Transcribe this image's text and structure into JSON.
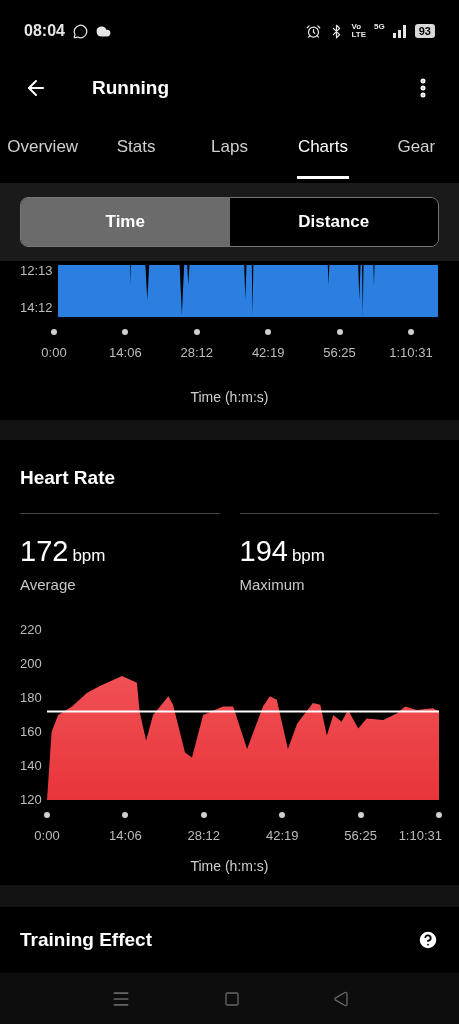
{
  "status_bar": {
    "time": "08:04",
    "battery": "93",
    "network": "5G",
    "volte_top": "Vo",
    "volte_bottom": "LTE"
  },
  "header": {
    "title": "Running"
  },
  "tabs": [
    {
      "label": "Overview",
      "selected": false
    },
    {
      "label": "Stats",
      "selected": false
    },
    {
      "label": "Laps",
      "selected": false
    },
    {
      "label": "Charts",
      "selected": true
    },
    {
      "label": "Gear",
      "selected": false
    }
  ],
  "segments": [
    {
      "label": "Time",
      "selected": true
    },
    {
      "label": "Distance",
      "selected": false
    }
  ],
  "pace_chart": {
    "y_ticks": [
      "12:13",
      "14:12"
    ],
    "x_ticks": [
      "0:00",
      "14:06",
      "28:12",
      "42:19",
      "56:25",
      "1:10:31"
    ],
    "xlabel": "Time (h:m:s)"
  },
  "heart_rate": {
    "title": "Heart Rate",
    "stats": [
      {
        "value": "172",
        "unit": "bpm",
        "label": "Average"
      },
      {
        "value": "194",
        "unit": "bpm",
        "label": "Maximum"
      }
    ],
    "chart_data": {
      "type": "area",
      "xlabel": "Time (h:m:s)",
      "x": [
        0,
        50,
        120,
        270,
        430,
        570,
        810,
        970,
        1000,
        1070,
        1145,
        1310,
        1360,
        1490,
        1565,
        1685,
        1900,
        2010,
        2160,
        2330,
        2405,
        2480,
        2600,
        2700,
        2870,
        2950,
        3020,
        3090,
        3180,
        3250,
        3360,
        3450,
        3630,
        3780,
        3865,
        3990,
        4165,
        4231
      ],
      "series": [
        {
          "color": "#e8353a",
          "values": [
            120,
            160,
            170,
            175,
            183,
            187,
            193,
            189,
            172,
            155,
            170,
            181,
            176,
            148,
            145,
            170,
            175,
            175,
            150,
            175,
            181,
            179,
            150,
            165,
            177,
            176,
            158,
            170,
            166,
            173,
            162,
            168,
            167,
            171,
            175,
            173,
            174,
            172
          ]
        },
        {
          "type": "line",
          "color": "#ffffff",
          "values": [
            172,
            172,
            172,
            172,
            172,
            172,
            172,
            172,
            172,
            172,
            172,
            172,
            172,
            172,
            172,
            172,
            172,
            172,
            172,
            172,
            172,
            172,
            172,
            172,
            172,
            172,
            172,
            172,
            172,
            172,
            172,
            172,
            172,
            172,
            172,
            172,
            172,
            172
          ]
        }
      ],
      "xlim": [
        0,
        4231
      ],
      "ylim": [
        120,
        220
      ],
      "xticks": [
        {
          "value": 0,
          "label": "0:00"
        },
        {
          "value": 846,
          "label": "14:06"
        },
        {
          "value": 1692,
          "label": "28:12"
        },
        {
          "value": 2539,
          "label": "42:19"
        },
        {
          "value": 3385,
          "label": "56:25"
        },
        {
          "value": 4231,
          "label": "1:10:31"
        }
      ],
      "yticks": [
        120,
        140,
        160,
        180,
        200,
        220
      ]
    }
  },
  "training_effect": {
    "title": "Training Effect"
  }
}
